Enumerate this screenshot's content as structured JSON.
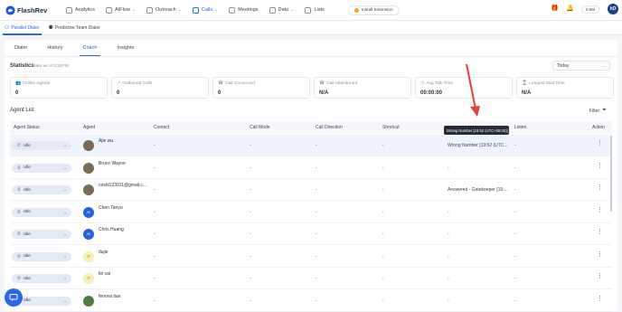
{
  "app": {
    "brand": "FlashRev"
  },
  "nav": {
    "items": [
      {
        "label": "Analytics",
        "icon": "analytics-icon"
      },
      {
        "label": "AIFlow",
        "icon": "aiflow-icon",
        "has_chevron": true
      },
      {
        "label": "Outreach",
        "icon": "outreach-icon",
        "has_chevron": true
      },
      {
        "label": "Calls",
        "icon": "calls-icon",
        "has_chevron": true,
        "active": true
      },
      {
        "label": "Meetings",
        "icon": "meetings-icon"
      },
      {
        "label": "Data",
        "icon": "data-icon",
        "has_chevron": true
      },
      {
        "label": "Lists",
        "icon": "lists-icon"
      }
    ],
    "install_label": "Install Extension",
    "status_label": "0.5M",
    "avatar_initials": "hD"
  },
  "subnav": {
    "items": [
      {
        "label": "Parallel Dialer",
        "active": true
      },
      {
        "label": "Predictive Team Dialer"
      }
    ]
  },
  "tabs": [
    "Dialer",
    "History",
    "Coach",
    "Insights"
  ],
  "active_tab": "Coach",
  "stats": {
    "title": "Statistics",
    "subtitle": "Data as of 2:24PM",
    "period": "Today",
    "cards": [
      {
        "label": "Online Agents",
        "value": "0"
      },
      {
        "label": "Outbound Calls",
        "value": "0"
      },
      {
        "label": "Call Connected",
        "value": "0"
      },
      {
        "label": "Call Abandoned",
        "value": "N/A"
      },
      {
        "label": "Avg Talk Time",
        "value": "00:00:00"
      },
      {
        "label": "Longest Wait Time",
        "value": "N/A"
      }
    ]
  },
  "agent_list": {
    "title": "Agent List",
    "filter_label": "Filter",
    "columns": [
      "Agent Status",
      "Agent",
      "Contact",
      "Call Mode",
      "Call Direction",
      "Shortcut",
      "Listen",
      "Action"
    ],
    "rows": [
      {
        "status": "Idle",
        "name": "Ajie wu",
        "sub": "-",
        "contact": "-",
        "mode": "-",
        "direction": "-",
        "shortcut": "-",
        "disposition": "Wrong Number [19:52 (UTC...",
        "listen": "-",
        "highlight": true,
        "avatar": "photo"
      },
      {
        "status": "Idle",
        "name": "Bruce Wayne",
        "sub": "-",
        "contact": "-",
        "mode": "-",
        "direction": "-",
        "shortcut": "-",
        "disposition": "-",
        "listen": "-",
        "avatar": "photo"
      },
      {
        "status": "Idle",
        "name": "ceshi123911@gmail.c...",
        "sub": "-",
        "contact": "-",
        "mode": "-",
        "direction": "-",
        "shortcut": "-",
        "disposition": "Answered - Gatekeeper [19:...",
        "listen": "-",
        "avatar": "photo"
      },
      {
        "status": "Idle",
        "name": "Chen Tanyu",
        "sub": "-",
        "contact": "-",
        "mode": "-",
        "direction": "-",
        "shortcut": "-",
        "disposition": "-",
        "listen": "-",
        "avatar": "blue"
      },
      {
        "status": "Idle",
        "name": "Chris Huang",
        "sub": "-",
        "contact": "-",
        "mode": "-",
        "direction": "-",
        "shortcut": "-",
        "disposition": "-",
        "listen": "-",
        "avatar": "blue"
      },
      {
        "status": "Idle",
        "name": "dujie",
        "sub": "-",
        "contact": "-",
        "mode": "-",
        "direction": "-",
        "shortcut": "-",
        "disposition": "-",
        "listen": "-",
        "avatar": "pale"
      },
      {
        "status": "Idle",
        "name": "fei cai",
        "sub": "-",
        "contact": "-",
        "mode": "-",
        "direction": "-",
        "shortcut": "-",
        "disposition": "-",
        "listen": "-",
        "avatar": "pale"
      },
      {
        "status": "Idle",
        "name": "fenova tian",
        "sub": "-",
        "contact": "-",
        "mode": "-",
        "direction": "-",
        "shortcut": "-",
        "disposition": "-",
        "listen": "-",
        "avatar": "green"
      }
    ]
  },
  "tooltip": "Wrong Number [19:52 (UTC+08:00)]",
  "colors": {
    "accent": "#2a67e8",
    "annotation_arrow": "#e0413a"
  }
}
